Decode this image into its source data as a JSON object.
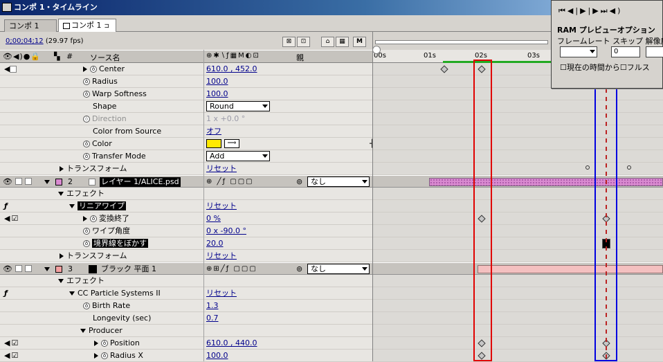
{
  "window": {
    "title": "コンポ 1・タイムライン"
  },
  "tabs": [
    {
      "label": "コンポ 1"
    },
    {
      "label": "コンポ 1"
    }
  ],
  "timecode": {
    "value": "0;00;04;12",
    "fps": "(29.97 fps)"
  },
  "columns": {
    "num": "#",
    "source": "ソース名",
    "parent": "親"
  },
  "ruler": {
    "ticks": [
      "00s",
      "01s",
      "02s",
      "03s"
    ]
  },
  "ram_preview": {
    "title": "RAM プレビューオプション",
    "labels": "フレームレート スキップ  解像度",
    "skip_value": "0",
    "check1": "現在の時間から",
    "check2": "フルス"
  },
  "rows": [
    {
      "name": "Center",
      "value": "610.0 , 452.0"
    },
    {
      "name": "Radius",
      "value": "100.0"
    },
    {
      "name": "Warp Softness",
      "value": "100.0"
    },
    {
      "name": "Shape",
      "value": "Round"
    },
    {
      "name": "Direction",
      "value": "1 x +0.0 °"
    },
    {
      "name": "Color from Source",
      "value": "オフ"
    },
    {
      "name": "Color",
      "value": ""
    },
    {
      "name": "Transfer Mode",
      "value": "Add"
    },
    {
      "name": "トランスフォーム",
      "value": "リセット"
    },
    {
      "num": "2",
      "name": "レイヤー 1/ALICE.psd",
      "parent": "なし"
    },
    {
      "name": "エフェクト",
      "value": ""
    },
    {
      "name": "リニアワイプ",
      "value": "リセット"
    },
    {
      "name": "変換終了",
      "value": "0 %"
    },
    {
      "name": "ワイプ角度",
      "value": "0 x -90.0 °"
    },
    {
      "name": "境界線をぼかす",
      "value": "20.0"
    },
    {
      "name": "トランスフォーム",
      "value": "リセット"
    },
    {
      "num": "3",
      "name": "ブラック 平面 1",
      "parent": "なし"
    },
    {
      "name": "エフェクト",
      "value": ""
    },
    {
      "name": "CC Particle Systems II",
      "value": "リセット"
    },
    {
      "name": "Birth Rate",
      "value": "1.3"
    },
    {
      "name": "Longevity (sec)",
      "value": "0.7"
    },
    {
      "name": "Producer",
      "value": ""
    },
    {
      "name": "Position",
      "value": "610.0 , 440.0"
    },
    {
      "name": "Radius X",
      "value": "100.0"
    }
  ],
  "colors": {
    "layer2_bar": "#d98ad0",
    "layer3_bar": "#f4c0c0",
    "color_swatch": "#ffea00",
    "workarea": "#22aa22"
  }
}
